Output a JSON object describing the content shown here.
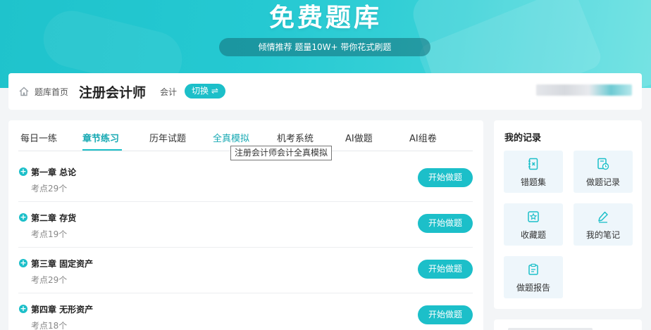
{
  "hero": {
    "title": "免费题库",
    "subtitle": "倾情推荐 题量10W+ 带你花式刷题"
  },
  "topbar": {
    "breadcrumb_home": "题库首页",
    "exam_title": "注册会计师",
    "subject": "会计",
    "switch_label": "切换 ⇌"
  },
  "tabs": [
    {
      "label": "每日一练"
    },
    {
      "label": "章节练习"
    },
    {
      "label": "历年试题"
    },
    {
      "label": "全真模拟"
    },
    {
      "label": "机考系统"
    },
    {
      "label": "AI做题"
    },
    {
      "label": "AI组卷"
    }
  ],
  "active_tab": "章节练习",
  "tooltip": "注册会计师会计全真模拟",
  "chapters": [
    {
      "title": "第一章 总论",
      "meta": "考点29个",
      "button": "开始做题"
    },
    {
      "title": "第二章 存货",
      "meta": "考点19个",
      "button": "开始做题"
    },
    {
      "title": "第三章 固定资产",
      "meta": "考点29个",
      "button": "开始做题"
    },
    {
      "title": "第四章 无形资产",
      "meta": "考点18个",
      "button": "开始做题"
    }
  ],
  "records": {
    "title": "我的记录",
    "items": [
      {
        "label": "错题集",
        "icon": "wrong-notebook-icon"
      },
      {
        "label": "做题记录",
        "icon": "history-record-icon"
      },
      {
        "label": "收藏题",
        "icon": "favorite-star-icon"
      },
      {
        "label": "我的笔记",
        "icon": "pencil-note-icon"
      },
      {
        "label": "做题报告",
        "icon": "report-clipboard-icon"
      }
    ]
  },
  "colors": {
    "accent": "#1cbfc9",
    "accent_text": "#17a9b3",
    "hero_start": "#1fc3cc",
    "hero_end": "#62dfe0"
  }
}
